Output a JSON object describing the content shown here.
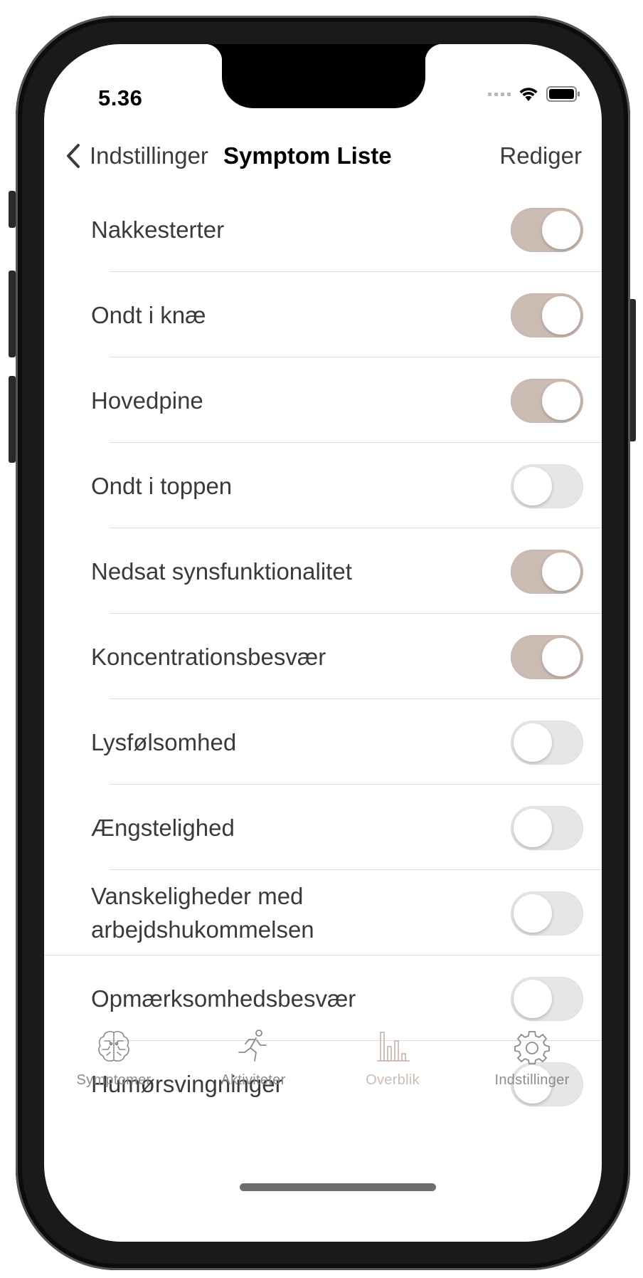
{
  "status_bar": {
    "time": "5.36"
  },
  "nav": {
    "back_label": "Indstillinger",
    "title": "Symptom Liste",
    "edit_label": "Rediger"
  },
  "symptoms": [
    {
      "label": "Nakkesterter",
      "enabled": true
    },
    {
      "label": "Ondt i knæ",
      "enabled": true
    },
    {
      "label": "Hovedpine",
      "enabled": true
    },
    {
      "label": "Ondt i toppen",
      "enabled": false
    },
    {
      "label": "Nedsat synsfunktionalitet",
      "enabled": true
    },
    {
      "label": "Koncentrationsbesvær",
      "enabled": true
    },
    {
      "label": "Lysfølsomhed",
      "enabled": false
    },
    {
      "label": "Ængstelighed",
      "enabled": false
    },
    {
      "label": "Vanskeligheder med arbejdshukommelsen",
      "enabled": false
    },
    {
      "label": "Opmærksomhedsbesvær",
      "enabled": false
    },
    {
      "label": "Humørsvingninger",
      "enabled": false
    }
  ],
  "tabs": [
    {
      "label": "Symptomer",
      "icon": "brain-icon",
      "active": false
    },
    {
      "label": "Aktiviteter",
      "icon": "runner-icon",
      "active": false
    },
    {
      "label": "Overblik",
      "icon": "bar-chart-icon",
      "active": true
    },
    {
      "label": "Indstillinger",
      "icon": "gear-icon",
      "active": false
    }
  ],
  "colors": {
    "accent": "#cbbcb3",
    "toggle_off": "#e6e6e6",
    "text": "#3a3a3a",
    "tab_inactive": "#8c8c8c"
  }
}
